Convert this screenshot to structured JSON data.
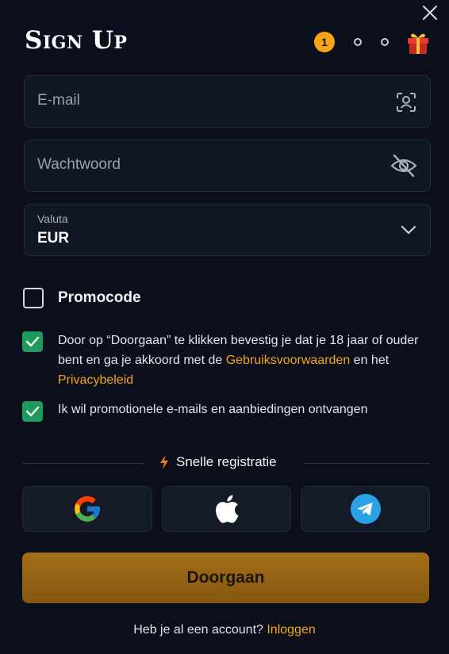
{
  "dialog": {
    "title": "Sign Up"
  },
  "steps": {
    "current": "1",
    "total": 3
  },
  "form": {
    "email": {
      "value": "",
      "placeholder": "E-mail"
    },
    "password": {
      "value": "",
      "placeholder": "Wachtwoord"
    },
    "currency": {
      "label": "Valuta",
      "value": "EUR"
    },
    "promocode": {
      "label": "Promocode",
      "checked": false
    },
    "terms": {
      "checked": true,
      "text_before": "Door op “Doorgaan” te klikken bevestig je dat je 18 jaar of ouder bent en ga je akkoord met de ",
      "terms_link": "Gebruiksvoorwaarden",
      "text_middle": " en het ",
      "privacy_link": "Privacybeleid"
    },
    "marketing": {
      "checked": true,
      "label": "Ik wil promotionele e-mails en aanbiedingen ontvangen"
    }
  },
  "quick_register": {
    "label": "Snelle registratie",
    "providers": [
      "google-icon",
      "apple-icon",
      "telegram-icon"
    ]
  },
  "submit": {
    "label": "Doorgaan"
  },
  "footer": {
    "question": "Heb je al een account? ",
    "login_link": "Inloggen"
  },
  "colors": {
    "accent": "#f5a516",
    "background": "#0b0f1b",
    "checkbox": "#1f9a5c",
    "button": "#a56f18"
  }
}
